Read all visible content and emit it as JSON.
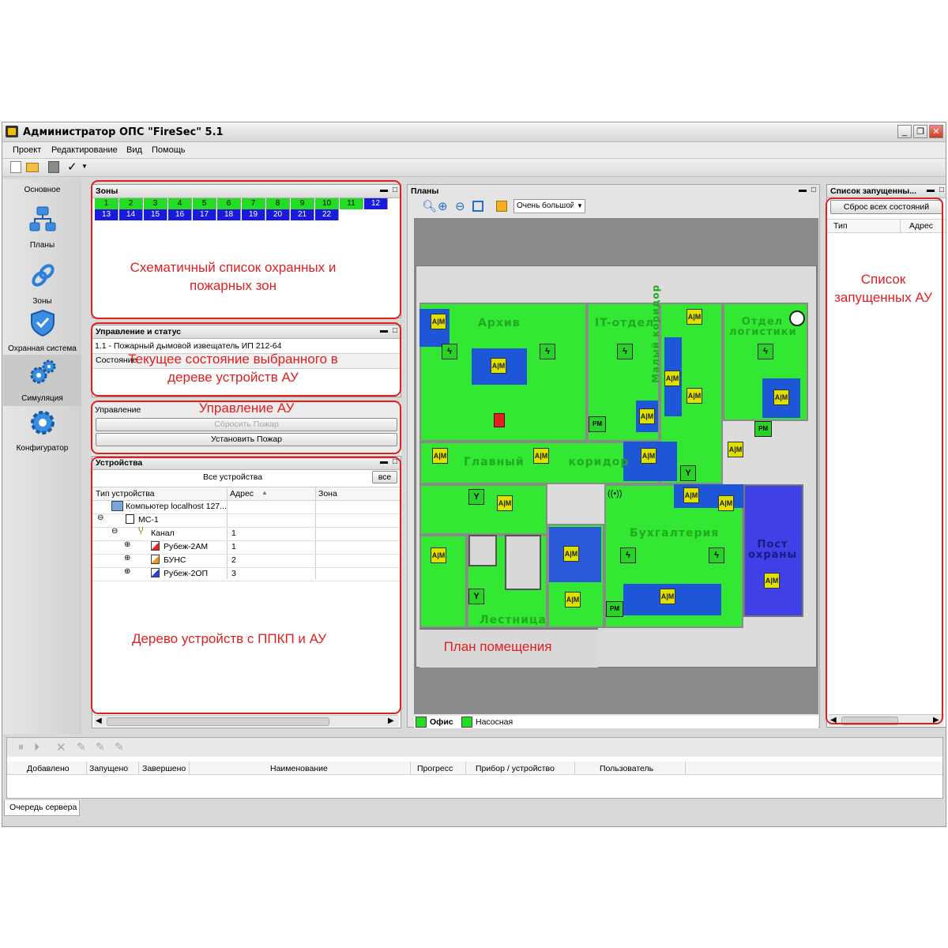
{
  "window": {
    "title": "Администратор ОПС \"FireSec\" 5.1"
  },
  "menu": [
    "Проект",
    "Редактирование",
    "Вид",
    "Помощь"
  ],
  "nav": {
    "header": "Основное",
    "items": [
      {
        "label": "Планы",
        "icon": "plans-icon"
      },
      {
        "label": "Зоны",
        "icon": "zones-icon"
      },
      {
        "label": "Охранная система",
        "icon": "shield-icon"
      },
      {
        "label": "Симуляция",
        "icon": "gears-icon"
      },
      {
        "label": "Конфигуратор",
        "icon": "gear-icon"
      }
    ]
  },
  "zones": {
    "title": "Зоны",
    "row1": [
      "1",
      "2",
      "3",
      "4",
      "5",
      "6",
      "7",
      "8",
      "9",
      "10",
      "11",
      "12"
    ],
    "row2": [
      "13",
      "14",
      "15",
      "16",
      "17",
      "18",
      "19",
      "20",
      "21",
      "22"
    ],
    "colors": {
      "green": "#22dd22",
      "blue": "#1a1adc"
    }
  },
  "status": {
    "title": "Управление и статус",
    "device": "1.1 - Пожарный дымовой извещатель ИП 212-64",
    "state_label": "Состояние"
  },
  "control": {
    "label": "Управление",
    "reset_button": "Сбросить Пожар",
    "set_button": "Установить Пожар"
  },
  "devices": {
    "title": "Устройства",
    "filter_label": "Все устройства",
    "all_button": "все",
    "columns": [
      "Тип устройства",
      "Адрес",
      "Зона"
    ],
    "rows": [
      {
        "name": "Компьютер localhost 127...",
        "address": "",
        "zone": ""
      },
      {
        "name": "МС-1",
        "address": "",
        "zone": ""
      },
      {
        "name": "Канал",
        "address": "1",
        "zone": ""
      },
      {
        "name": "Рубеж-2АМ",
        "address": "1",
        "zone": ""
      },
      {
        "name": "БУНС",
        "address": "2",
        "zone": ""
      },
      {
        "name": "Рубеж-2ОП",
        "address": "3",
        "zone": ""
      }
    ]
  },
  "plans": {
    "title": "Планы",
    "zoom_value": "Очень большой",
    "rooms": [
      "Архив",
      "IT-отдел",
      "Отдел логистики",
      "Малый коридор",
      "Главный коридор",
      "Бухгалтерия",
      "Пост охраны",
      "Лестница"
    ],
    "tabs": [
      "Офис",
      "Насосная"
    ]
  },
  "launched": {
    "title": "Список запущенны...",
    "reset_all_button": "Сброс всех состояний",
    "columns": [
      "Тип",
      "Адрес"
    ]
  },
  "queue": {
    "columns": [
      "Добавлено",
      "Запущено",
      "Завершено",
      "Наименование",
      "Прогресс",
      "Прибор / устройство",
      "Пользователь"
    ],
    "tab": "Очередь сервера"
  },
  "annotations": {
    "zones": "Схематичный список охранных и пожарных зон",
    "status": "Текущее состояние выбранного в дереве устройств АУ",
    "control": "Управление АУ",
    "devices": "Дерево устройств с ППКП и АУ",
    "plan": "План помещения",
    "launched": "Список запущенных АУ"
  },
  "text": {
    "bold_am": "А|М",
    "pm": "PM",
    "stairs": "Лестница"
  }
}
